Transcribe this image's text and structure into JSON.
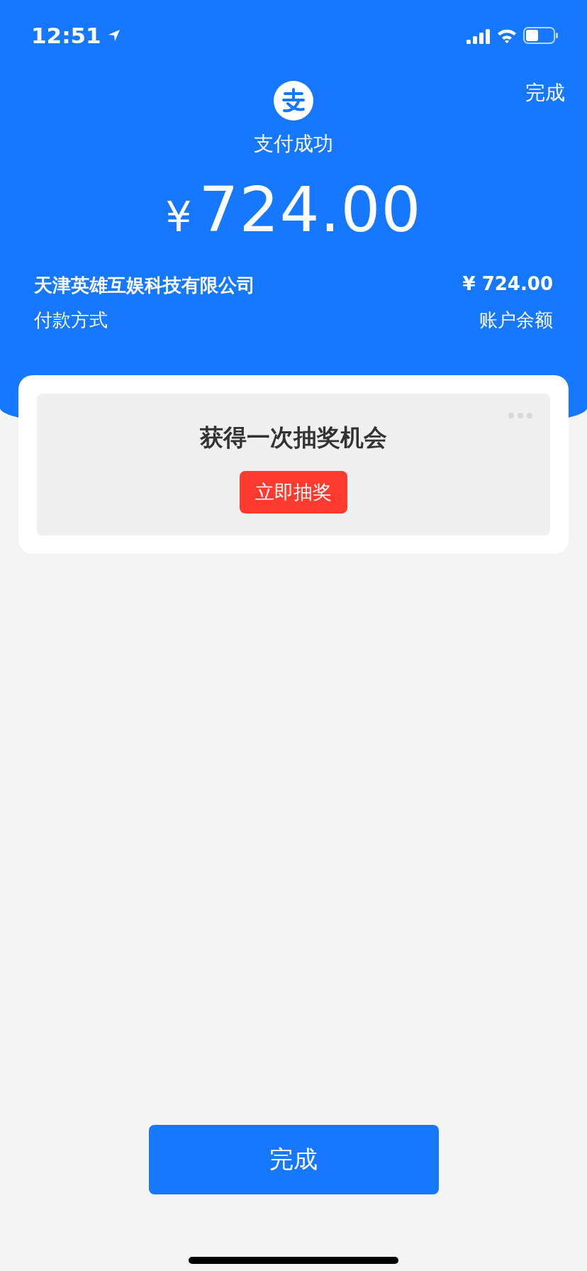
{
  "status_bar": {
    "time": "12:51"
  },
  "header": {
    "done_link": "完成",
    "title": "支付成功",
    "currency": "¥",
    "amount": "724.00"
  },
  "details": [
    {
      "label": "天津英雄互娱科技有限公司",
      "value": "¥ 724.00",
      "kind": "strong"
    },
    {
      "label": "付款方式",
      "value": "账户余额",
      "kind": "plain"
    }
  ],
  "promo": {
    "title": "获得一次抽奖机会",
    "button": "立即抽奖"
  },
  "done_button": "完成"
}
